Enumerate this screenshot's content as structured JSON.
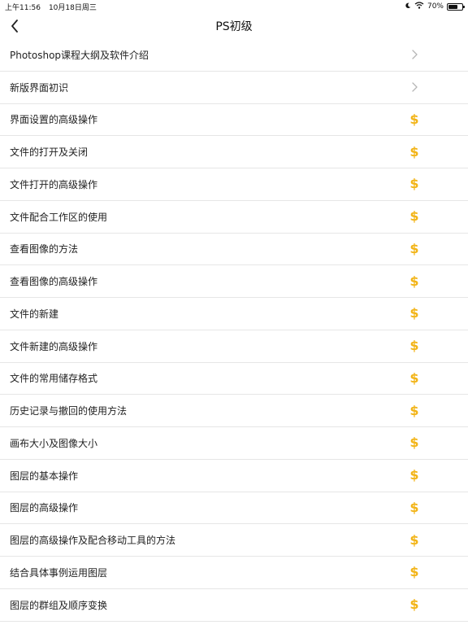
{
  "status_bar": {
    "time": "上午11:56",
    "date": "10月18日周三",
    "battery_percent": "70%",
    "battery_level": 0.7
  },
  "nav": {
    "title": "PS初级",
    "back_icon": "chevron-left-icon"
  },
  "colors": {
    "price_icon": "#f2b417",
    "chevron": "#b5b5b5"
  },
  "items": [
    {
      "label": "Photoshop课程大纲及软件介绍",
      "trailing": "chevron"
    },
    {
      "label": "新版界面初识",
      "trailing": "chevron"
    },
    {
      "label": "界面设置的高级操作",
      "trailing": "price",
      "price_symbol": "$"
    },
    {
      "label": "文件的打开及关闭",
      "trailing": "price",
      "price_symbol": "$"
    },
    {
      "label": "文件打开的高级操作",
      "trailing": "price",
      "price_symbol": "$"
    },
    {
      "label": "文件配合工作区的使用",
      "trailing": "price",
      "price_symbol": "$"
    },
    {
      "label": "查看图像的方法",
      "trailing": "price",
      "price_symbol": "$"
    },
    {
      "label": "查看图像的高级操作",
      "trailing": "price",
      "price_symbol": "$"
    },
    {
      "label": "文件的新建",
      "trailing": "price",
      "price_symbol": "$"
    },
    {
      "label": "文件新建的高级操作",
      "trailing": "price",
      "price_symbol": "$"
    },
    {
      "label": "文件的常用储存格式",
      "trailing": "price",
      "price_symbol": "$"
    },
    {
      "label": "历史记录与撤回的使用方法",
      "trailing": "price",
      "price_symbol": "$"
    },
    {
      "label": "画布大小及图像大小",
      "trailing": "price",
      "price_symbol": "$"
    },
    {
      "label": "图层的基本操作",
      "trailing": "price",
      "price_symbol": "$"
    },
    {
      "label": "图层的高级操作",
      "trailing": "price",
      "price_symbol": "$"
    },
    {
      "label": "图层的高级操作及配合移动工具的方法",
      "trailing": "price",
      "price_symbol": "$"
    },
    {
      "label": "结合具体事例运用图层",
      "trailing": "price",
      "price_symbol": "$"
    },
    {
      "label": "图层的群组及顺序变换",
      "trailing": "price",
      "price_symbol": "$"
    }
  ]
}
